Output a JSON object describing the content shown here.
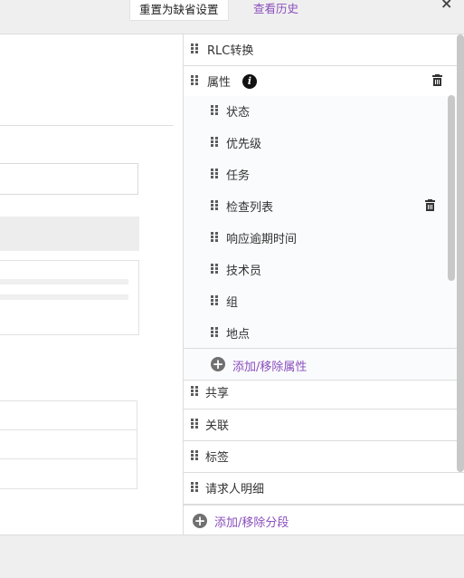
{
  "topbar": {
    "reset_label": "重置为缺省设置",
    "history_label": "查看历史",
    "close_glyph": "×"
  },
  "sections": {
    "rlc": "RLC转换",
    "attributes": "属性",
    "info_glyph": "i",
    "share": "共享",
    "related": "关联",
    "tags": "标签",
    "requester_partial": "请求人明细"
  },
  "attributes": {
    "items": [
      {
        "label": "状态"
      },
      {
        "label": "优先级"
      },
      {
        "label": "任务"
      },
      {
        "label": "检查列表"
      },
      {
        "label": "响应逾期时间"
      },
      {
        "label": "技术员"
      },
      {
        "label": "组"
      },
      {
        "label": "地点"
      }
    ],
    "add_remove_label": "添加/移除属性",
    "plus_glyph": "+"
  },
  "bottom": {
    "add_remove_sections_label": "添加/移除分段",
    "plus_glyph": "+"
  },
  "colors": {
    "link": "#8a4fbd",
    "panel_bg": "#fafbfc",
    "chrome_bg": "#efefef"
  }
}
